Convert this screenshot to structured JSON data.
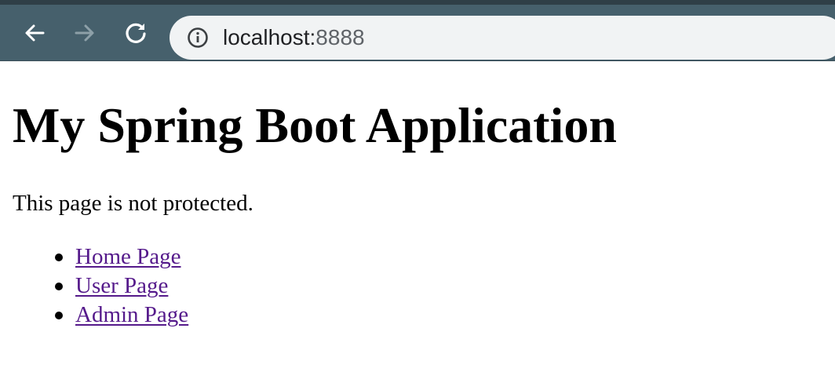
{
  "browser": {
    "url_host": "localhost:",
    "url_port": "8888",
    "icons": {
      "back": "back-arrow-icon",
      "forward": "forward-arrow-icon",
      "reload": "reload-icon",
      "site_info": "info-icon"
    },
    "colors": {
      "toolbar": "#46606c",
      "address_bar": "#f1f3f4"
    }
  },
  "page": {
    "title": "My Spring Boot Application",
    "paragraph": "This page is not protected.",
    "links": [
      {
        "label": "Home Page"
      },
      {
        "label": "User Page"
      },
      {
        "label": "Admin Page"
      }
    ],
    "colors": {
      "visited_link": "#551a8b"
    }
  }
}
